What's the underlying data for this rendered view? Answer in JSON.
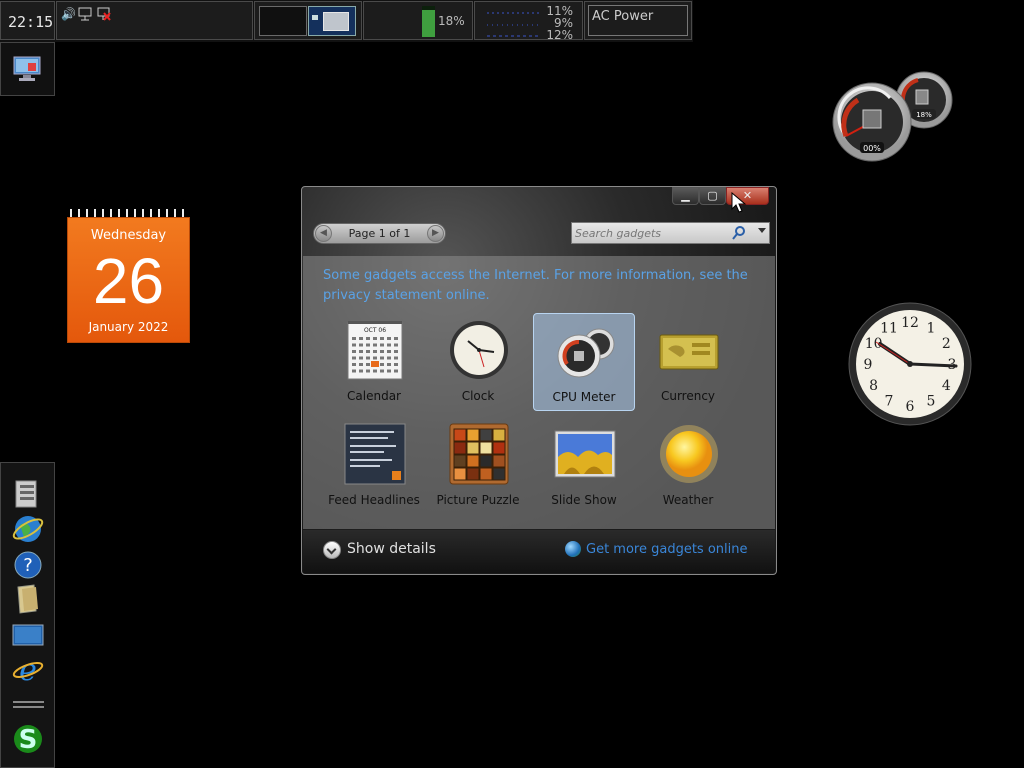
{
  "top_panel": {
    "clock": "22:15",
    "tray_icons": [
      "volume-icon",
      "network-icon",
      "network-disconnected-icon"
    ],
    "cpu_percent": "18%",
    "cpu_level": 0.88,
    "net_values": [
      "11%",
      "9%",
      "12%"
    ],
    "power_label": "AC Power"
  },
  "calendar_gadget": {
    "weekday": "Wednesday",
    "day": "26",
    "month_year": "January 2022"
  },
  "gadget_window": {
    "pager_label": "Page 1 of 1",
    "search_placeholder": "Search gadgets",
    "info_text": "Some gadgets access the Internet. For more information, see the privacy statement online.",
    "gadgets": [
      {
        "label": "Calendar",
        "icon": "calendar-icon"
      },
      {
        "label": "Clock",
        "icon": "clock-icon"
      },
      {
        "label": "CPU Meter",
        "icon": "cpu-meter-icon",
        "selected": true
      },
      {
        "label": "Currency",
        "icon": "currency-icon"
      },
      {
        "label": "Feed Headlines",
        "icon": "feed-headlines-icon"
      },
      {
        "label": "Picture Puzzle",
        "icon": "picture-puzzle-icon"
      },
      {
        "label": "Slide Show",
        "icon": "slide-show-icon"
      },
      {
        "label": "Weather",
        "icon": "weather-icon"
      }
    ],
    "calendar_icon_month": "OCT 06",
    "show_details_label": "Show details",
    "get_more_label": "Get more gadgets online"
  },
  "cpu_meter_gadget": {
    "cpu_value": "00%",
    "memory_value": "18%"
  },
  "clock_gadget": {
    "numerals": [
      "12",
      "1",
      "2",
      "3",
      "4",
      "5",
      "6",
      "7",
      "8",
      "9",
      "10",
      "11"
    ]
  },
  "colors": {
    "calendar_orange": "#e8640f",
    "link_blue": "#3a86d8",
    "cpu_bar_green": "#3f9f3f"
  }
}
